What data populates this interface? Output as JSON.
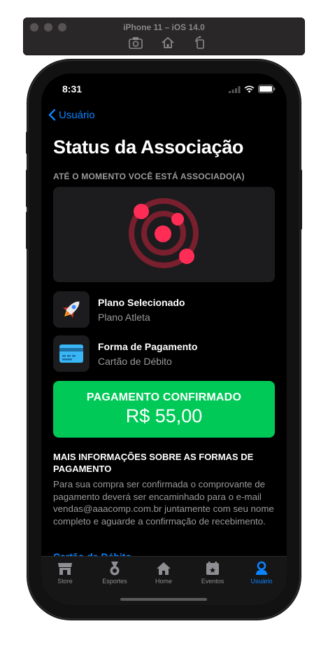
{
  "simulator": {
    "title": "iPhone 11 – iOS 14.0"
  },
  "status_bar": {
    "time": "8:31"
  },
  "nav": {
    "back_label": "Usuário"
  },
  "page": {
    "title": "Status da Associação",
    "section_label": "ATÉ O MOMENTO VOCÊ ESTÁ ASSOCIADO(A)"
  },
  "plan": {
    "title": "Plano Selecionado",
    "value": "Plano Atleta",
    "icon": "rocket-icon"
  },
  "payment_method": {
    "title": "Forma de Pagamento",
    "value": "Cartão de Débito",
    "icon": "credit-card-icon"
  },
  "payment_status": {
    "status": "PAGAMENTO CONFIRMADO",
    "amount": "R$ 55,00"
  },
  "info": {
    "heading": "MAIS INFORMAÇÕES SOBRE AS FORMAS DE PAGAMENTO",
    "body": "Para sua compra ser confirmada o comprovante de pagamento deverá ser encaminhado para o e-mail  vendas@aaacomp.com.br juntamente com seu nome completo e aguarde a confirmação de recebimento.",
    "link": "Cartão de Débito"
  },
  "tabs": [
    {
      "label": "Store",
      "icon": "store-icon"
    },
    {
      "label": "Esportes",
      "icon": "medal-icon"
    },
    {
      "label": "Home",
      "icon": "home-icon"
    },
    {
      "label": "Eventos",
      "icon": "calendar-icon"
    },
    {
      "label": "Usuário",
      "icon": "user-icon",
      "active": true
    }
  ],
  "colors": {
    "accent": "#0a84ff",
    "confirmed": "#00c957",
    "hero_red": "#ff2d55",
    "hero_dark_red": "#7a1f2e"
  }
}
